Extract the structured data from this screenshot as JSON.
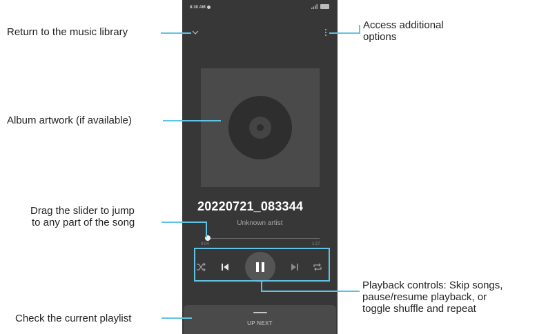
{
  "status_bar": {
    "time": "8:30 AM"
  },
  "player": {
    "song_title": "20220721_083344",
    "artist": "Unknown artist",
    "elapsed": "0:04",
    "duration": "1:27",
    "progress": 0.05,
    "up_next_label": "UP NEXT"
  },
  "callouts": {
    "back": "Return to the music library",
    "options_line1": "Access additional",
    "options_line2": "options",
    "artwork": "Album artwork (if available)",
    "slider_line1": "Drag the slider to jump",
    "slider_line2": "to any part of the song",
    "controls_line1": "Playback controls: Skip songs,",
    "controls_line2": "pause/resume playback, or",
    "controls_line3": "toggle shuffle and repeat",
    "playlist": "Check the current playlist"
  },
  "colors": {
    "callout_line": "#5fc3e4",
    "phone_background": "#373737"
  }
}
